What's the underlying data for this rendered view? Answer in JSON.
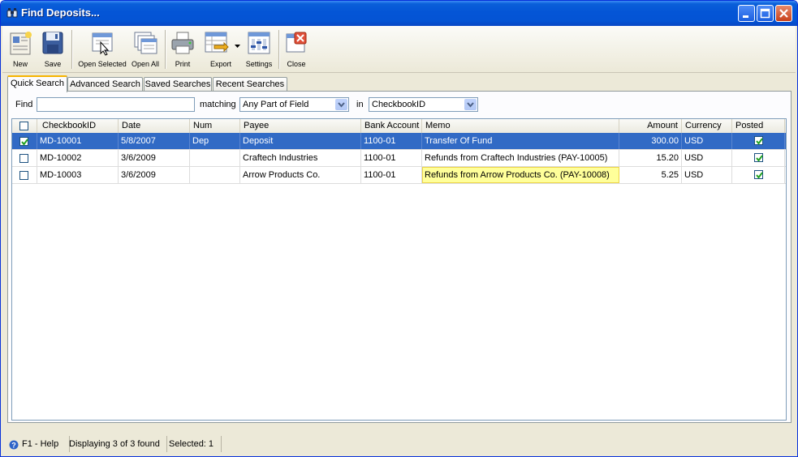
{
  "window": {
    "title": "Find Deposits...",
    "accent": "#316ac5"
  },
  "toolbar": {
    "new_label": "New",
    "save_label": "Save",
    "open_selected_label": "Open Selected",
    "open_all_label": "Open All",
    "print_label": "Print",
    "export_label": "Export",
    "settings_label": "Settings",
    "close_label": "Close"
  },
  "tabs": [
    {
      "label": "Quick Search",
      "active": true
    },
    {
      "label": "Advanced Search",
      "active": false
    },
    {
      "label": "Saved Searches",
      "active": false
    },
    {
      "label": "Recent Searches",
      "active": false
    }
  ],
  "search": {
    "find_label": "Find",
    "find_value": "",
    "matching_label": "matching",
    "matching_value": "Any Part of Field",
    "in_label": "in",
    "in_value": "CheckbookID"
  },
  "grid": {
    "columns": [
      "CheckbookID",
      "Date",
      "Num",
      "Payee",
      "Bank Account",
      "Memo",
      "Amount",
      "Currency",
      "Posted"
    ],
    "rows": [
      {
        "checked": true,
        "id": "MD-10001",
        "date": "5/8/2007",
        "num": "Dep",
        "payee": "Deposit",
        "bank": "1100-01",
        "memo": "Transfer Of Fund",
        "amount": "300.00",
        "currency": "USD",
        "posted": true,
        "selected": true
      },
      {
        "checked": false,
        "id": "MD-10002",
        "date": "3/6/2009",
        "num": "",
        "payee": "Craftech Industries",
        "bank": "1100-01",
        "memo": "Refunds from Craftech Industries (PAY-10005)",
        "amount": "15.20",
        "currency": "USD",
        "posted": true,
        "selected": false
      },
      {
        "checked": false,
        "id": "MD-10003",
        "date": "3/6/2009",
        "num": "",
        "payee": "Arrow Products Co.",
        "bank": "1100-01",
        "memo": "Refunds from Arrow Products Co. (PAY-10008)",
        "amount": "5.25",
        "currency": "USD",
        "posted": true,
        "selected": false,
        "memo_highlighted": true
      }
    ]
  },
  "status": {
    "help": "F1 - Help",
    "displaying": "Displaying 3 of 3 found",
    "selected": "Selected: 1"
  }
}
